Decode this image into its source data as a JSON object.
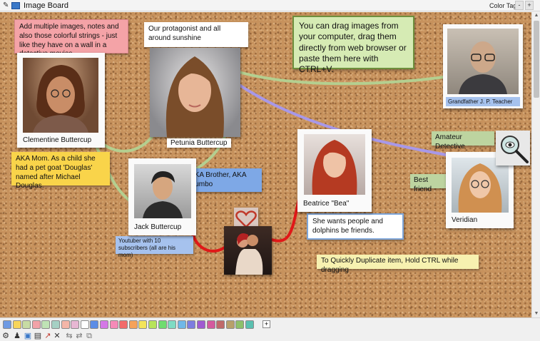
{
  "window": {
    "title": "Image Board",
    "color_tag_label": "Color Tag",
    "minimize_label": "-",
    "maximize_label": "+"
  },
  "notes": {
    "intro": "Add multiple images, notes and also those colorful strings - just like they have on a wall in a detective movies.",
    "protagonist": "Our protagonist and all around sunshine",
    "drag_tip": "You can drag images from your computer, drag them directly from web browser or paste them here with CTRL+V.",
    "aka_mom": "AKA Mom. As a child she had a pet goat  'Douglas' named after Michael Douglas.",
    "aka_brother": "AKA Brother, AKA Dumbo",
    "youtuber": "Youtuber with 10 subscribers (all are his mom)",
    "wants": "She wants people and dolphins be friends.",
    "duplicate_tip": "To Quickly Duplicate item, Hold CTRL while dragging",
    "amateur": "Amateur Detective",
    "best_friend": "Best friend"
  },
  "photos": {
    "clementine": "Clementine Buttercup",
    "petunia": "Petunia Buttercup",
    "jack": "Jack Buttercup",
    "beatrice": "Beatrice \"Bea\"",
    "veridian": "Veridian",
    "grandfather": "Grandfather J. P. Teacher"
  },
  "colors": {
    "note_pink": "#f4a3a7",
    "note_white": "#ffffff",
    "note_green": "#d6ebb4",
    "note_yellow": "#f9d44a",
    "note_blue": "#7ea8e6",
    "note_lightblue": "#a6c2ee",
    "note_cream": "#f7f1b0",
    "note_sage": "#bdd4a0",
    "string_green": "#b4cf90",
    "string_purple": "#a898e8",
    "string_red": "#e01818"
  },
  "palette": [
    "#6e9ae3",
    "#f7d55a",
    "#c7dba4",
    "#f2a2a8",
    "#bfe3b5",
    "#a6d0c4",
    "#f4b6a8",
    "#e7b7d3",
    "#ffffff",
    "#5b8de6",
    "#d478e6",
    "#f58ab8",
    "#f26b6b",
    "#f5a25a",
    "#f4e45a",
    "#b7e35a",
    "#6fdc6f",
    "#7fdcc4",
    "#6fb8e8",
    "#7d7de0",
    "#a05ad1",
    "#d45a9e",
    "#c06a6a",
    "#b8a06a",
    "#8ec06a",
    "#5ac0b0"
  ],
  "palette_add_label": "+",
  "toolbar_icons": [
    "gear-icon",
    "people-icon",
    "image-icon",
    "note-icon",
    "string-icon",
    "delete-icon",
    "link-icon",
    "unlink-icon",
    "group-icon"
  ]
}
